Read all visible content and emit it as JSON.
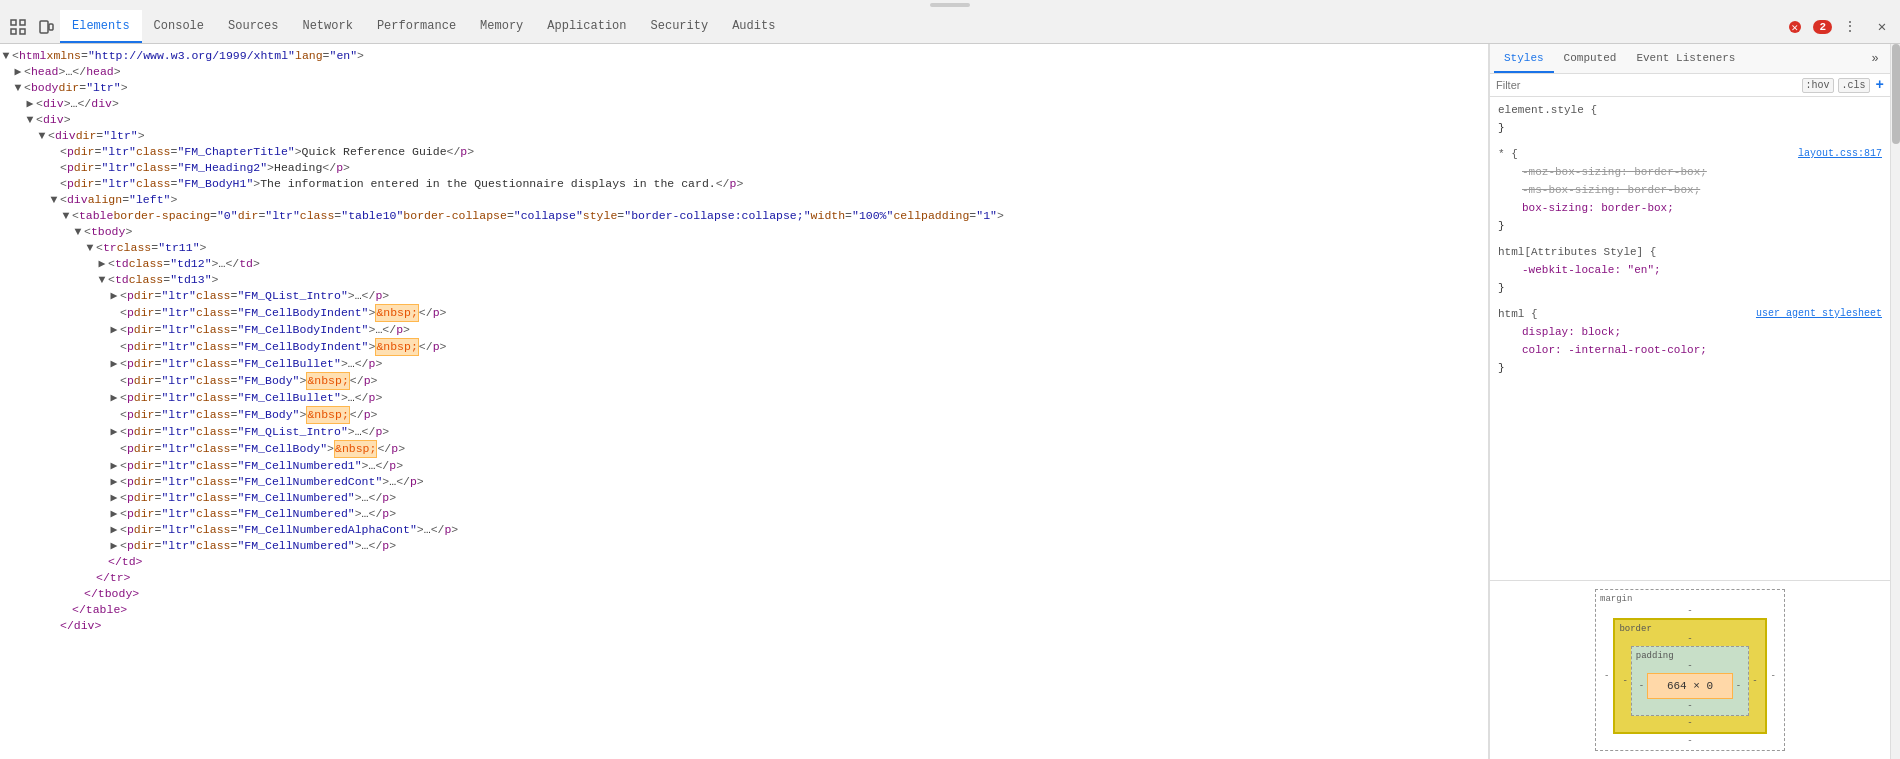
{
  "toolbar": {
    "tabs": [
      {
        "id": "elements",
        "label": "Elements",
        "active": true
      },
      {
        "id": "console",
        "label": "Console"
      },
      {
        "id": "sources",
        "label": "Sources"
      },
      {
        "id": "network",
        "label": "Network"
      },
      {
        "id": "performance",
        "label": "Performance"
      },
      {
        "id": "memory",
        "label": "Memory"
      },
      {
        "id": "application",
        "label": "Application"
      },
      {
        "id": "security",
        "label": "Security"
      },
      {
        "id": "audits",
        "label": "Audits"
      }
    ],
    "error_count": "2",
    "more_icon": "⋮",
    "close_icon": "✕"
  },
  "dom_tree": {
    "lines": [
      {
        "indent": 0,
        "toggle": "▼",
        "content": "<html xmlns=\"http://www.w3.org/1999/xhtml\" lang=\"en\">",
        "type": "tag"
      },
      {
        "indent": 1,
        "toggle": "▶",
        "content": "<head>…</head>",
        "type": "tag"
      },
      {
        "indent": 1,
        "toggle": "▼",
        "content": "<body dir=\"ltr\">",
        "type": "tag"
      },
      {
        "indent": 2,
        "toggle": "▶",
        "content": "<div>…</div>",
        "type": "tag"
      },
      {
        "indent": 2,
        "toggle": "▼",
        "content": "<div>",
        "type": "tag"
      },
      {
        "indent": 3,
        "toggle": "▼",
        "content": "<div dir=\"ltr\">",
        "type": "tag"
      },
      {
        "indent": 4,
        "toggle": "",
        "content": "<p dir=\"ltr\" class=\"FM_ChapterTitle\">Quick Reference Guide</p>",
        "type": "tag"
      },
      {
        "indent": 4,
        "toggle": "",
        "content": "<p dir=\"ltr\" class=\"FM_Heading2\">Heading</p>",
        "type": "tag"
      },
      {
        "indent": 4,
        "toggle": "",
        "content": "<p dir=\"ltr\" class=\"FM_BodyH1\">The information entered in the Questionnaire displays in the card.</p>",
        "type": "tag"
      },
      {
        "indent": 4,
        "toggle": "▼",
        "content": "<div align=\"left\">",
        "type": "tag"
      },
      {
        "indent": 5,
        "toggle": "▼",
        "content": "<table border-spacing=\"0\" dir=\"ltr\" class=\"table10\" border-collapse=\"collapse\" style=\"border-collapse:collapse;\" width=\"100%\" cellpadding=\"1\">",
        "type": "tag"
      },
      {
        "indent": 6,
        "toggle": "▼",
        "content": "<tbody>",
        "type": "tag"
      },
      {
        "indent": 7,
        "toggle": "▼",
        "content": "<tr class=\"tr11\">",
        "type": "tag"
      },
      {
        "indent": 8,
        "toggle": "▶",
        "content": "<td class=\"td12\">…</td>",
        "type": "tag"
      },
      {
        "indent": 8,
        "toggle": "▼",
        "content": "<td class=\"td13\">",
        "type": "tag"
      },
      {
        "indent": 9,
        "toggle": "▶",
        "content": "<p dir=\"ltr\" class=\"FM_QList_Intro\">…</p>",
        "type": "tag"
      },
      {
        "indent": 9,
        "toggle": "",
        "content": "<p dir=\"ltr\" class=\"FM_CellBodyIndent\">&nbsp;</p>",
        "type": "tag_nbsp"
      },
      {
        "indent": 9,
        "toggle": "▶",
        "content": "<p dir=\"ltr\" class=\"FM_CellBodyIndent\">…</p>",
        "type": "tag"
      },
      {
        "indent": 9,
        "toggle": "",
        "content": "<p dir=\"ltr\" class=\"FM_CellBodyIndent\">&nbsp;</p>",
        "type": "tag_nbsp"
      },
      {
        "indent": 9,
        "toggle": "▶",
        "content": "<p dir=\"ltr\" class=\"FM_CellBullet\">…</p>",
        "type": "tag"
      },
      {
        "indent": 9,
        "toggle": "",
        "content": "<p dir=\"ltr\" class=\"FM_Body\">&nbsp;</p>",
        "type": "tag_nbsp"
      },
      {
        "indent": 9,
        "toggle": "▶",
        "content": "<p dir=\"ltr\" class=\"FM_CellBullet\">…</p>",
        "type": "tag"
      },
      {
        "indent": 9,
        "toggle": "",
        "content": "<p dir=\"ltr\" class=\"FM_Body\">&nbsp;</p>",
        "type": "tag_nbsp"
      },
      {
        "indent": 9,
        "toggle": "▶",
        "content": "<p dir=\"ltr\" class=\"FM_QList_Intro\">…</p>",
        "type": "tag"
      },
      {
        "indent": 9,
        "toggle": "",
        "content": "<p dir=\"ltr\" class=\"FM_CellBody\">&nbsp;</p>",
        "type": "tag_nbsp"
      },
      {
        "indent": 9,
        "toggle": "▶",
        "content": "<p dir=\"ltr\" class=\"FM_CellNumbered1\">…</p>",
        "type": "tag"
      },
      {
        "indent": 9,
        "toggle": "▶",
        "content": "<p dir=\"ltr\" class=\"FM_CellNumberedCont\">…</p>",
        "type": "tag"
      },
      {
        "indent": 9,
        "toggle": "▶",
        "content": "<p dir=\"ltr\" class=\"FM_CellNumbered\">…</p>",
        "type": "tag"
      },
      {
        "indent": 9,
        "toggle": "▶",
        "content": "<p dir=\"ltr\" class=\"FM_CellNumbered\">…</p>",
        "type": "tag"
      },
      {
        "indent": 9,
        "toggle": "▶",
        "content": "<p dir=\"ltr\" class=\"FM_CellNumberedAlphaCont\">…</p>",
        "type": "tag"
      },
      {
        "indent": 9,
        "toggle": "▶",
        "content": "<p dir=\"ltr\" class=\"FM_CellNumbered\">…</p>",
        "type": "tag"
      },
      {
        "indent": 8,
        "toggle": "",
        "content": "</td>",
        "type": "close"
      },
      {
        "indent": 7,
        "toggle": "",
        "content": "</tr>",
        "type": "close"
      },
      {
        "indent": 6,
        "toggle": "",
        "content": "</tbody>",
        "type": "close"
      },
      {
        "indent": 5,
        "toggle": "",
        "content": "</table>",
        "type": "close"
      },
      {
        "indent": 4,
        "toggle": "",
        "content": "</div>",
        "type": "close_small"
      }
    ]
  },
  "styles_panel": {
    "tabs": [
      {
        "id": "styles",
        "label": "Styles",
        "active": true
      },
      {
        "id": "computed",
        "label": "Computed"
      },
      {
        "id": "event-listeners",
        "label": "Event Listeners"
      },
      {
        "id": "more",
        "label": "»"
      }
    ],
    "filter_placeholder": "Filter",
    "filter_hov": ":hov",
    "filter_cls": ".cls",
    "filter_plus": "+",
    "rules": [
      {
        "selector": "element.style {",
        "source": "",
        "props": [],
        "close": "}"
      },
      {
        "selector": "* {",
        "source": "layout.css:817",
        "props": [
          {
            "name": "-moz-box-sizing: border-box;",
            "strike": true
          },
          {
            "name": "-ms-box-sizing: border-box;",
            "strike": true
          },
          {
            "name": "box-sizing: border-box;",
            "strike": false
          }
        ],
        "close": "}"
      },
      {
        "selector": "html[Attributes Style] {",
        "source": "",
        "props": [
          {
            "name": "-webkit-locale: \"en\";",
            "strike": false
          }
        ],
        "close": "}"
      },
      {
        "selector": "html {",
        "source": "user agent stylesheet",
        "props": [
          {
            "name": "display: block;",
            "strike": false
          },
          {
            "name": "color: -internal-root-color;",
            "strike": false
          }
        ],
        "close": "}"
      }
    ],
    "box_model": {
      "title": "margin",
      "margin_val": "-",
      "border_val": "-",
      "border_label": "border",
      "padding_val": "-",
      "padding_label": "padding",
      "content_val": "664 × 0",
      "sides": {
        "top": "-",
        "right": "-",
        "bottom": "-",
        "left": "-"
      }
    }
  }
}
